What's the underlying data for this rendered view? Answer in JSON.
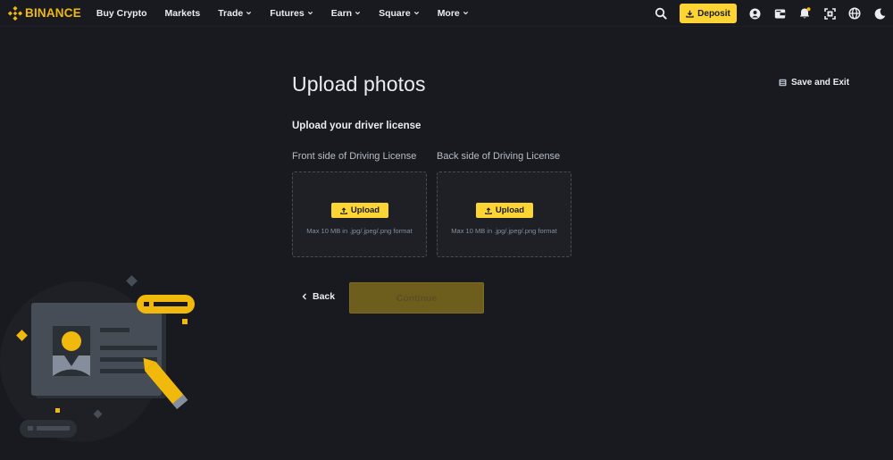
{
  "header": {
    "logo_text": "BINANCE",
    "nav": [
      {
        "label": "Buy Crypto",
        "dropdown": false
      },
      {
        "label": "Markets",
        "dropdown": false
      },
      {
        "label": "Trade",
        "dropdown": true
      },
      {
        "label": "Futures",
        "dropdown": true
      },
      {
        "label": "Earn",
        "dropdown": true
      },
      {
        "label": "Square",
        "dropdown": true
      },
      {
        "label": "More",
        "dropdown": true
      }
    ],
    "deposit_label": "Deposit",
    "icons": [
      "search-icon",
      "download-icon",
      "user-icon",
      "wallet-icon",
      "bell-icon",
      "qr-icon",
      "globe-icon",
      "moon-icon"
    ]
  },
  "main": {
    "title": "Upload photos",
    "save_exit_label": "Save and Exit",
    "section_title": "Upload your driver license",
    "uploads": [
      {
        "label": "Front side of Driving License",
        "button": "Upload",
        "hint": "Max 10 MB in .jpg/.jpeg/.png format"
      },
      {
        "label": "Back side of Driving License",
        "button": "Upload",
        "hint": "Max 10 MB in .jpg/.jpeg/.png format"
      }
    ],
    "back_label": "Back",
    "continue_label": "Continue"
  },
  "colors": {
    "background": "#181a20",
    "accent": "#fcd535",
    "brand": "#f0b90b",
    "text": "#eaecef",
    "muted": "#848e9c"
  }
}
